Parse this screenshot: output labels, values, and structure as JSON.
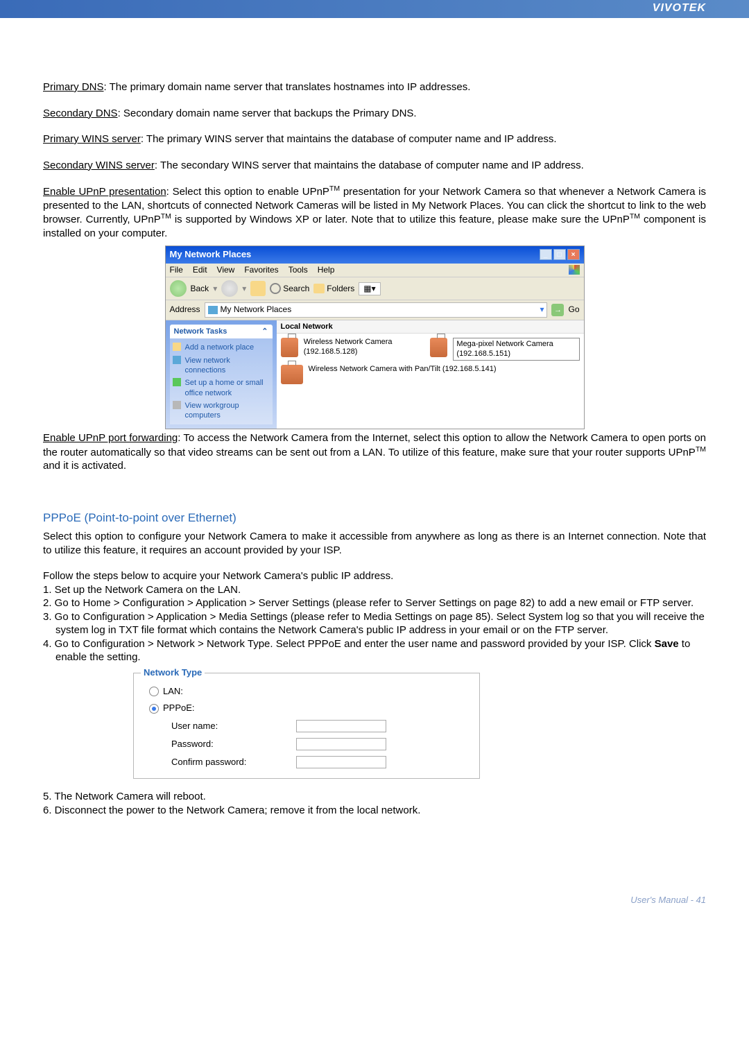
{
  "header": {
    "brand": "VIVOTEK"
  },
  "defs": {
    "primary_dns_label": "Primary DNS",
    "primary_dns_text": ": The primary domain name server that translates hostnames into IP addresses.",
    "secondary_dns_label": "Secondary DNS",
    "secondary_dns_text": ": Secondary domain name server that backups the Primary DNS.",
    "primary_wins_label": "Primary WINS server",
    "primary_wins_text": ": The primary WINS server that maintains the database of computer name and IP address.",
    "secondary_wins_label": "Secondary WINS server",
    "secondary_wins_text": ": The secondary WINS server that maintains the database of computer name and IP address.",
    "upnp_pres_label": "Enable UPnP presentation",
    "upnp_pres_text1": ": Select this option to enable UPnP",
    "tm": "TM",
    "upnp_pres_text2": " presentation for your Network Camera so that whenever a Network Camera is presented to the LAN, shortcuts of connected Network Cameras will be listed in My Network Places. You can click the shortcut to link to the web browser. Currently, UPnP",
    "upnp_pres_text3": " is supported by Windows XP or later. Note that to utilize this feature, please make sure the UPnP",
    "upnp_pres_text4": " component is installed on your computer.",
    "upnp_fwd_label": "Enable UPnP port forwarding",
    "upnp_fwd_text1": ": To access the Network Camera from the Internet, select this option to allow the Network Camera to open ports on the router automatically so that video streams can be sent out from a LAN. To utilize of this feature, make sure that your router supports UPnP",
    "upnp_fwd_text2": " and it is activated."
  },
  "win": {
    "title": "My Network Places",
    "menu": {
      "file": "File",
      "edit": "Edit",
      "view": "View",
      "favorites": "Favorites",
      "tools": "Tools",
      "help": "Help"
    },
    "toolbar": {
      "back": "Back",
      "search": "Search",
      "folders": "Folders"
    },
    "address_label": "Address",
    "address_value": "My Network Places",
    "go": "Go",
    "side": {
      "header": "Network Tasks",
      "items": [
        "Add a network place",
        "View network connections",
        "Set up a home or small office network",
        "View workgroup computers"
      ]
    },
    "local_header": "Local Network",
    "cams": [
      {
        "name": "Wireless Network Camera (192.168.5.128)"
      },
      {
        "name": "Mega-pixel Network Camera (192.168.5.151)"
      },
      {
        "name": "Wireless Network Camera with Pan/Tilt (192.168.5.141)"
      }
    ]
  },
  "pppoe": {
    "title": "PPPoE (Point-to-point over Ethernet)",
    "intro": "Select this option to configure your Network Camera to make it accessible from anywhere as long as there is an Internet connection. Note that to utilize this feature, it requires an account provided by your ISP.",
    "follow": "Follow the steps below to acquire your Network Camera's public IP address.",
    "s1": "1. Set up the Network Camera on the LAN.",
    "s2": "2. Go to Home > Configuration > Application > Server Settings (please refer to Server Settings on page 82) to add a new email or FTP server.",
    "s3": "3. Go to Configuration > Application > Media Settings (please refer to Media Settings on page 85). Select System log so that you will receive the system log in TXT file format which contains the Network Camera's public IP address in your email or on the FTP server.",
    "s4a": "4. Go to Configuration > Network > Network Type. Select PPPoE and enter the user name and password provided by your ISP. Click ",
    "s4b": "Save",
    "s4c": " to enable the setting.",
    "s5": "5. The Network Camera will reboot.",
    "s6": "6. Disconnect the power to the Network Camera; remove it from the local network."
  },
  "netform": {
    "legend": "Network Type",
    "lan": "LAN:",
    "pppoe": "PPPoE:",
    "user": "User name:",
    "pass": "Password:",
    "confirm": "Confirm password:"
  },
  "footer": {
    "text": "User's Manual - 41"
  }
}
